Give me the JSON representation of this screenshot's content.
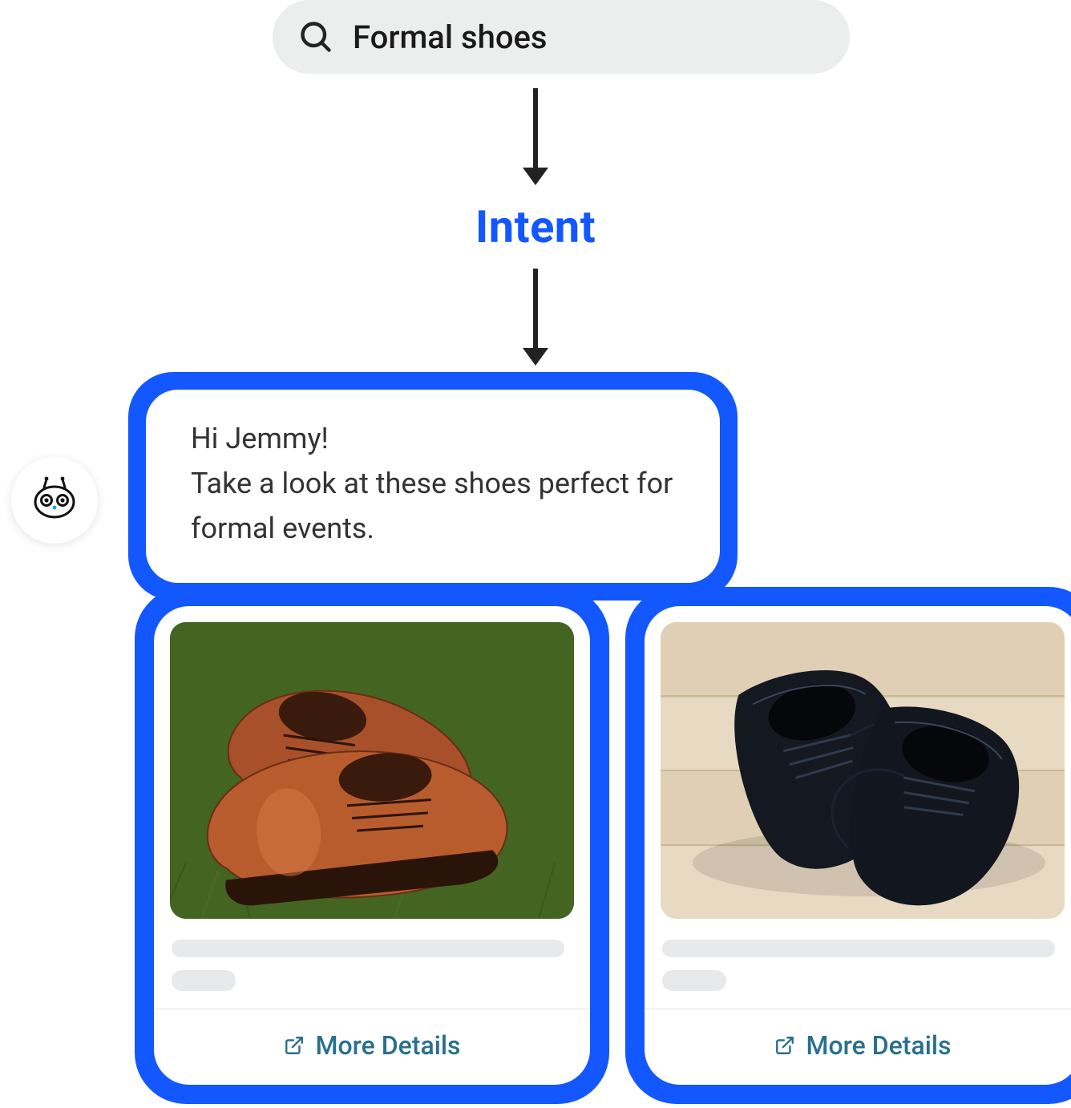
{
  "search": {
    "query": "Formal shoes"
  },
  "flow": {
    "intent_label": "Intent"
  },
  "bubble": {
    "line1": "Hi Jemmy!",
    "line2": "Take a look at these shoes perfect for formal events."
  },
  "cards": [
    {
      "cta_label": "More Details"
    },
    {
      "cta_label": "More Details"
    }
  ]
}
